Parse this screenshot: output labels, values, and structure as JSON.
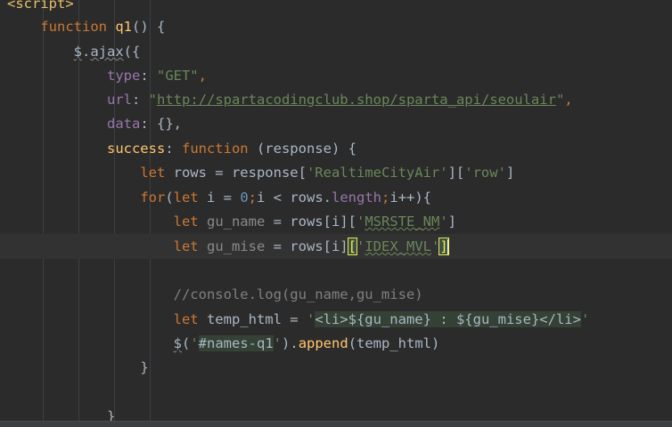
{
  "code": {
    "script_open": "<script>",
    "kw_function": "function",
    "q1": "q1",
    "q1_open": "() {",
    "dollar": "$",
    "dot_ajax": ".",
    "ajax": "ajax",
    "ajax_open": "({",
    "type_key": "type",
    "colon": ": ",
    "type_val": "\"GET\"",
    "comma": ",",
    "url_key": "url",
    "url_quote_open": "\"",
    "url_val": "http://spartacodingclub.shop/sparta_api/seoulair",
    "url_quote_close": "\"",
    "data_key": "data",
    "data_val": "{},",
    "success_key": "success",
    "success_fn": "function",
    "success_args": " (response) {",
    "kw_let": "let",
    "rows_decl": " rows = response[",
    "rtca": "'RealtimeCityAir'",
    "rows_mid": "][",
    "row": "'row'",
    "rows_close": "]",
    "kw_for": "for",
    "for_open": "(",
    "for_i": " i = ",
    "zero": "0",
    "semi": ";",
    "for_cond": "i < rows.",
    "length": "length",
    "for_end": "i++){",
    "gu_name": "gu_name",
    "gu_name_rest": " = rows[i][",
    "q_open": "'",
    "msrste": "MSRSTE_NM",
    "q_close": "'",
    "close_bracket": "]",
    "gu_mise": "gu_mise",
    "gu_mise_rest": " = rows[i]",
    "open_bracket": "[",
    "idex": "IDEX_MVL",
    "comment": "//console.log(gu_name,gu_mise)",
    "temp_html": " temp_html = ",
    "tpl_q1": "'",
    "li_open": "<li>",
    "tpl_mid": "${gu_name} : ${gu_mise}",
    "li_close": "</li>",
    "tpl_q2": "'",
    "jq_dollar": "$",
    "jq_paren": "(",
    "sel_q1": "'",
    "selector": "#names-q1",
    "sel_q2": "'",
    "append_pre": ").",
    "append": "append",
    "append_args": "(temp_html)",
    "brace": "}",
    "brace_bottom": "}"
  }
}
